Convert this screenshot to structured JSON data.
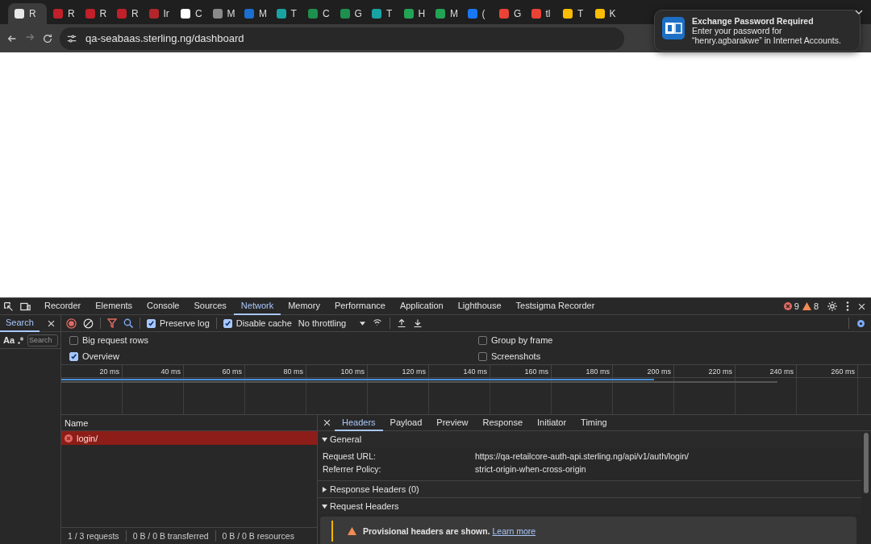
{
  "browser": {
    "tabs": [
      {
        "title": "R",
        "selected": true,
        "color": "#e8e8e8"
      },
      {
        "title": "R",
        "selected": false,
        "color": "#c0202a"
      },
      {
        "title": "R",
        "selected": false,
        "color": "#c0202a"
      },
      {
        "title": "R",
        "selected": false,
        "color": "#c0202a"
      },
      {
        "title": "Ir",
        "selected": false,
        "color": "#b3262b"
      },
      {
        "title": "C",
        "selected": false,
        "color": "#ffffff"
      },
      {
        "title": "M",
        "selected": false,
        "color": "#8a8a8a"
      },
      {
        "title": "M",
        "selected": false,
        "color": "#1a6fd0"
      },
      {
        "title": "T",
        "selected": false,
        "color": "#1aa3a3"
      },
      {
        "title": "C",
        "selected": false,
        "color": "#1f8f4e"
      },
      {
        "title": "G",
        "selected": false,
        "color": "#1f8f4e"
      },
      {
        "title": "T",
        "selected": false,
        "color": "#1aa3a3"
      },
      {
        "title": "H",
        "selected": false,
        "color": "#23a455"
      },
      {
        "title": "M",
        "selected": false,
        "color": "#23a455"
      },
      {
        "title": "(",
        "selected": false,
        "color": "#1877f2"
      },
      {
        "title": "G",
        "selected": false,
        "color": "#ea4335"
      },
      {
        "title": "tl",
        "selected": false,
        "color": "#ea4335"
      },
      {
        "title": "T",
        "selected": false,
        "color": "#fbbc04"
      },
      {
        "title": "K",
        "selected": false,
        "color": "#fbbc04"
      }
    ],
    "url": "qa-seabaas.sterling.ng/dashboard"
  },
  "notification": {
    "title": "Exchange Password Required",
    "lines": [
      "Enter your password for",
      "“henry.agbarakwe” in Internet Accounts."
    ]
  },
  "devtools": {
    "panel_tabs": [
      {
        "label": "Recorder",
        "selected": false
      },
      {
        "label": "Elements",
        "selected": false
      },
      {
        "label": "Console",
        "selected": false
      },
      {
        "label": "Sources",
        "selected": false
      },
      {
        "label": "Network",
        "selected": true
      },
      {
        "label": "Memory",
        "selected": false
      },
      {
        "label": "Performance",
        "selected": false
      },
      {
        "label": "Application",
        "selected": false
      },
      {
        "label": "Lighthouse",
        "selected": false
      },
      {
        "label": "Testsigma Recorder",
        "selected": false
      }
    ],
    "errors": "9",
    "warnings": "8",
    "search_pane": {
      "tab": "Search",
      "case_toggle": "Aa",
      "placeholder": "Search"
    },
    "toolbar": {
      "recording": true,
      "preserve_log": {
        "label": "Preserve log",
        "checked": true
      },
      "disable_cache": {
        "label": "Disable cache",
        "checked": true
      },
      "throttling": "No throttling"
    },
    "options": [
      {
        "label": "Big request rows",
        "checked": false
      },
      {
        "label": "Group by frame",
        "checked": false
      },
      {
        "label": "Overview",
        "checked": true
      },
      {
        "label": "Screenshots",
        "checked": false
      }
    ],
    "timeline_ticks": [
      "20 ms",
      "40 ms",
      "60 ms",
      "80 ms",
      "100 ms",
      "120 ms",
      "140 ms",
      "160 ms",
      "180 ms",
      "200 ms",
      "220 ms",
      "240 ms",
      "260 ms"
    ],
    "requests": {
      "column": "Name",
      "rows": [
        {
          "name": "login/",
          "failed": true,
          "selected": true
        }
      ]
    },
    "status": [
      "1 / 3 requests",
      "0 B / 0 B transferred",
      "0 B / 0 B resources"
    ],
    "details": {
      "tabs": [
        {
          "label": "Headers",
          "selected": true
        },
        {
          "label": "Payload",
          "selected": false
        },
        {
          "label": "Preview",
          "selected": false
        },
        {
          "label": "Response",
          "selected": false
        },
        {
          "label": "Initiator",
          "selected": false
        },
        {
          "label": "Timing",
          "selected": false
        }
      ],
      "sections": [
        {
          "title": "General",
          "expanded": true,
          "rows": [
            {
              "key": "Request URL:",
              "value": "https://qa-retailcore-auth-api.sterling.ng/api/v1/auth/login/"
            },
            {
              "key": "Referrer Policy:",
              "value": "strict-origin-when-cross-origin"
            }
          ]
        },
        {
          "title": "Response Headers (0)",
          "expanded": false
        },
        {
          "title": "Request Headers",
          "expanded": true,
          "warning": {
            "text": "Provisional headers are shown.",
            "link": "Learn more"
          }
        }
      ]
    }
  }
}
